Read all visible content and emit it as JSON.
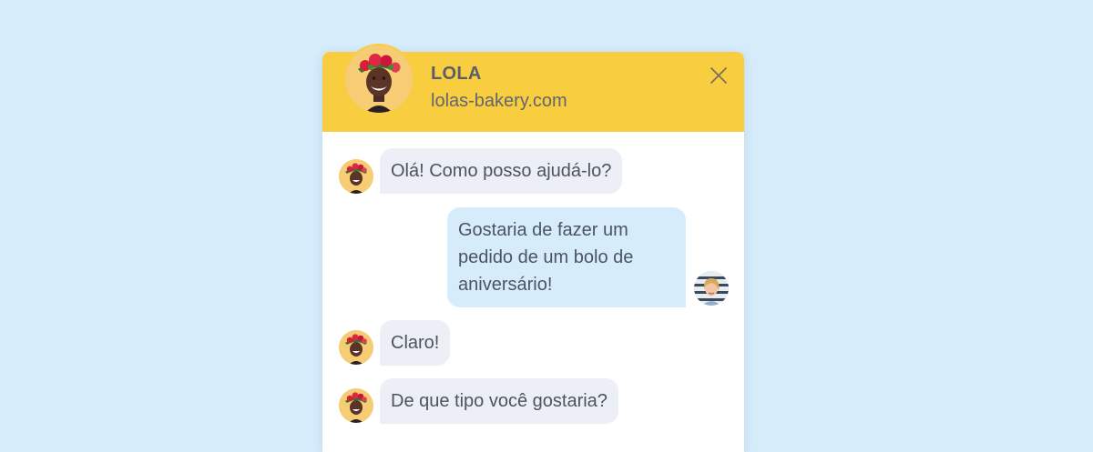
{
  "header": {
    "name": "LOLA",
    "site": "lolas-bakery.com",
    "avatar_icon": "agent-avatar-icon",
    "close_icon": "close-icon",
    "color": "#f8cd3f"
  },
  "messages": [
    {
      "sender": "agent",
      "text": "Olá! Como posso ajudá-lo?"
    },
    {
      "sender": "user",
      "text": "Gostaria de fazer um pedido de um bolo de aniversário!"
    },
    {
      "sender": "agent",
      "text": "Claro!"
    },
    {
      "sender": "agent",
      "text": "De que tipo você gostaria?"
    }
  ],
  "colors": {
    "background": "#d6ecfb",
    "agent_bubble": "#eceff5",
    "user_bubble": "#d6ecfb",
    "text": "#4d5461"
  }
}
